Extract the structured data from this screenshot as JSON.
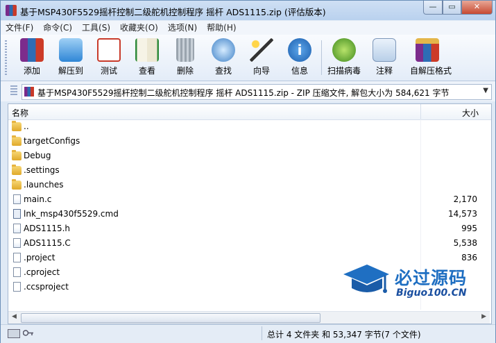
{
  "window": {
    "title": "基于MSP430F5529摇杆控制二级舵机控制程序 摇杆 ADS1115.zip (评估版本)",
    "minimize": "—",
    "maximize": "▭",
    "close": "✕"
  },
  "menu": [
    "文件(F)",
    "命令(C)",
    "工具(S)",
    "收藏夹(O)",
    "选项(N)",
    "帮助(H)"
  ],
  "toolbar": [
    {
      "label": "添加",
      "icon": "add-archive-icon"
    },
    {
      "label": "解压到",
      "icon": "extract-to-icon"
    },
    {
      "label": "测试",
      "icon": "test-icon"
    },
    {
      "label": "查看",
      "icon": "view-icon"
    },
    {
      "label": "删除",
      "icon": "delete-icon"
    },
    {
      "label": "查找",
      "icon": "find-icon"
    },
    {
      "label": "向导",
      "icon": "wizard-icon"
    },
    {
      "label": "信息",
      "icon": "info-icon"
    },
    {
      "label": "扫描病毒",
      "icon": "virus-scan-icon"
    },
    {
      "label": "注释",
      "icon": "comment-icon"
    },
    {
      "label": "自解压格式",
      "icon": "sfx-icon"
    }
  ],
  "address": {
    "text": "基于MSP430F5529摇杆控制二级舵机控制程序 摇杆 ADS1115.zip - ZIP 压缩文件, 解包大小为 584,621 字节"
  },
  "columns": {
    "name": "名称",
    "size": "大小"
  },
  "files": [
    {
      "name": "..",
      "size": "",
      "type": "folder"
    },
    {
      "name": "targetConfigs",
      "size": "",
      "type": "folder"
    },
    {
      "name": "Debug",
      "size": "",
      "type": "folder"
    },
    {
      "name": ".settings",
      "size": "",
      "type": "folder"
    },
    {
      "name": ".launches",
      "size": "",
      "type": "folder"
    },
    {
      "name": "main.c",
      "size": "2,170",
      "type": "cfile"
    },
    {
      "name": "lnk_msp430f5529.cmd",
      "size": "14,573",
      "type": "lnk"
    },
    {
      "name": "ADS1115.h",
      "size": "995",
      "type": "cfile"
    },
    {
      "name": "ADS1115.C",
      "size": "5,538",
      "type": "cfile"
    },
    {
      "name": ".project",
      "size": "836",
      "type": "file"
    },
    {
      "name": ".cproject",
      "size": "",
      "type": "file"
    },
    {
      "name": ".ccsproject",
      "size": "",
      "type": "file"
    }
  ],
  "status": {
    "text": "总计 4 文件夹 和 53,347 字节(7 个文件)"
  },
  "watermark": {
    "big": "必过源码",
    "small": "Biguo100.CN"
  }
}
